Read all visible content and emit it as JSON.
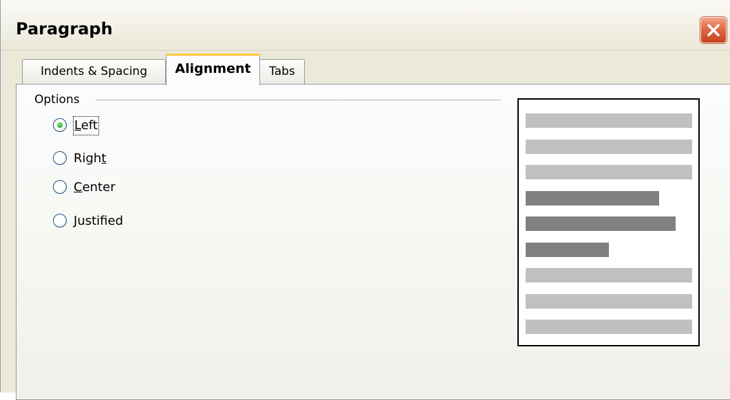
{
  "window": {
    "title": "Paragraph"
  },
  "tabs": [
    {
      "label": "Indents & Spacing",
      "active": false
    },
    {
      "label": "Alignment",
      "active": true
    },
    {
      "label": "Tabs",
      "active": false
    }
  ],
  "options": {
    "legend": "Options",
    "radios": [
      {
        "before": "",
        "mnemonic": "L",
        "after": "eft",
        "checked": true,
        "focused": true
      },
      {
        "before": "Righ",
        "mnemonic": "t",
        "after": "",
        "checked": false,
        "focused": false
      },
      {
        "before": "",
        "mnemonic": "C",
        "after": "enter",
        "checked": false,
        "focused": false
      },
      {
        "before": "",
        "mnemonic": "J",
        "after": "ustified",
        "checked": false,
        "focused": false
      }
    ]
  },
  "preview": {
    "light_color": "#c0c0c0",
    "dark_color": "#808080",
    "lines": [
      {
        "tone": "light",
        "length": 1.0
      },
      {
        "tone": "light",
        "length": 1.0
      },
      {
        "tone": "light",
        "length": 1.0
      },
      {
        "tone": "dark",
        "length": 0.8
      },
      {
        "tone": "dark",
        "length": 0.9
      },
      {
        "tone": "dark",
        "length": 0.5
      },
      {
        "tone": "light",
        "length": 1.0
      },
      {
        "tone": "light",
        "length": 1.0
      },
      {
        "tone": "light",
        "length": 1.0
      }
    ]
  },
  "icons": {
    "close": "close-icon",
    "radio": "radio-button-icon"
  }
}
